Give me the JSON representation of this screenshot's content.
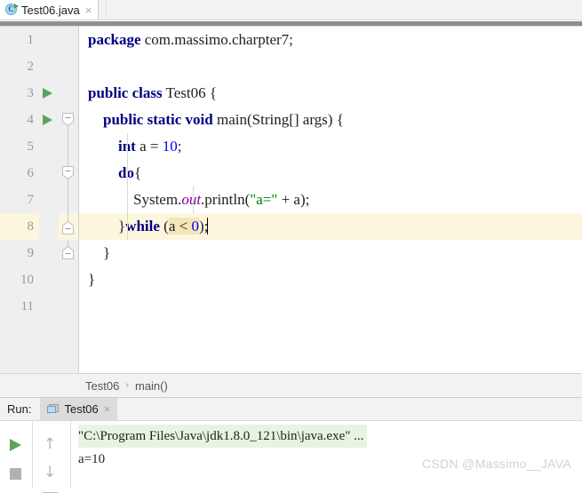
{
  "window": {
    "title": "Test06.java"
  },
  "tab_bar": {
    "tabs": [
      {
        "label": "Test06.java",
        "icon": "java-class-icon",
        "close": "×",
        "active": true
      }
    ]
  },
  "editor": {
    "lines": [
      {
        "number": "1",
        "gutter_run": false,
        "fold": "none",
        "current": false
      },
      {
        "number": "2",
        "gutter_run": false,
        "fold": "none",
        "current": false
      },
      {
        "number": "3",
        "gutter_run": true,
        "fold": "none",
        "current": false
      },
      {
        "number": "4",
        "gutter_run": true,
        "fold": "start",
        "current": false
      },
      {
        "number": "5",
        "gutter_run": false,
        "fold": "line",
        "current": false
      },
      {
        "number": "6",
        "gutter_run": false,
        "fold": "start",
        "current": false
      },
      {
        "number": "7",
        "gutter_run": false,
        "fold": "line",
        "current": false
      },
      {
        "number": "8",
        "gutter_run": false,
        "fold": "end",
        "current": true
      },
      {
        "number": "9",
        "gutter_run": false,
        "fold": "end",
        "current": false
      },
      {
        "number": "10",
        "gutter_run": false,
        "fold": "none",
        "current": false
      },
      {
        "number": "11",
        "gutter_run": false,
        "fold": "none",
        "current": false
      }
    ],
    "code_text": [
      "package com.massimo.charpter7;",
      "",
      "public class Test06 {",
      "    public static void main(String[] args) {",
      "        int a = 10;",
      "        do{",
      "            System.out.println(\"a=\" + a);",
      "        }while (a < 0);",
      "    }",
      "}",
      ""
    ],
    "highlighted_condition": "a < 0",
    "caret_line": "8"
  },
  "breadcrumb": {
    "items": [
      "Test06",
      "main()"
    ],
    "separator": "›"
  },
  "run_panel": {
    "label": "Run:",
    "tab": {
      "label": "Test06",
      "icon": "console-icon",
      "close": "×"
    },
    "toolbar": [
      {
        "name": "rerun-button",
        "icon": "play-icon"
      },
      {
        "name": "stop-button",
        "icon": "stop-icon"
      },
      {
        "name": "up-button",
        "icon": "arrow-up-icon",
        "glyph": "↑"
      },
      {
        "name": "down-button",
        "icon": "arrow-down-icon",
        "glyph": "↓"
      }
    ],
    "console_lines": [
      {
        "text": "\"C:\\Program Files\\Java\\jdk1.8.0_121\\bin\\java.exe\" ...",
        "style": "command"
      },
      {
        "text": "a=10",
        "style": "output"
      }
    ]
  },
  "watermark": {
    "text": "CSDN @Massimo__JAVA"
  },
  "colors": {
    "keyword": "#000080",
    "number": "#0000ff",
    "string": "#008000",
    "static_field": "#8000a0",
    "current_line": "#fdf6de",
    "condition_highlight": "#f3e6b8",
    "run_green": "#5ba35b",
    "console_command_bg": "#e8f4e2"
  }
}
